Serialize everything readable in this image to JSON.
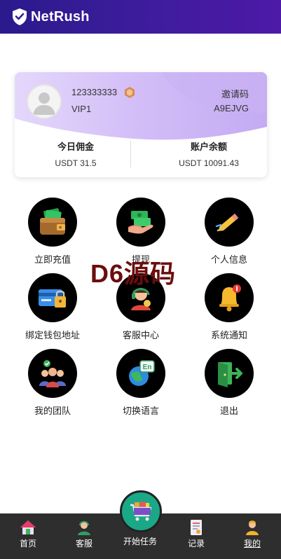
{
  "header": {
    "brand": "NetRush"
  },
  "profile": {
    "user_id": "123333333",
    "level": "VIP1",
    "invite_label": "邀请码",
    "invite_code": "A9EJVG"
  },
  "stats": {
    "commission_label": "今日佣金",
    "commission_value": "USDT 31.5",
    "balance_label": "账户余额",
    "balance_value": "USDT 10091.43"
  },
  "menu": {
    "items": [
      {
        "label": "立即充值",
        "icon": "wallet-icon"
      },
      {
        "label": "提现",
        "icon": "cash-hand-icon"
      },
      {
        "label": "个人信息",
        "icon": "pencil-icon"
      },
      {
        "label": "绑定钱包地址",
        "icon": "card-lock-icon"
      },
      {
        "label": "客服中心",
        "icon": "support-agent-icon"
      },
      {
        "label": "系统通知",
        "icon": "bell-icon"
      },
      {
        "label": "我的团队",
        "icon": "team-icon"
      },
      {
        "label": "切换语言",
        "icon": "language-icon"
      },
      {
        "label": "退出",
        "icon": "logout-icon"
      }
    ]
  },
  "watermark": "D6源码",
  "tabbar": {
    "items": [
      {
        "label": "首页",
        "icon": "home-icon"
      },
      {
        "label": "客服",
        "icon": "support-icon"
      },
      {
        "label": "开始任务",
        "icon": "cart-icon"
      },
      {
        "label": "记录",
        "icon": "records-icon"
      },
      {
        "label": "我的",
        "icon": "profile-icon",
        "active": true
      }
    ]
  },
  "colors": {
    "header_start": "#2a1a8c",
    "header_end": "#4d1aa8",
    "card_wave": "#c9b4f5",
    "tabbar": "#2e2e2e",
    "center_button": "#1aa886",
    "watermark": "#6b0d0d"
  }
}
